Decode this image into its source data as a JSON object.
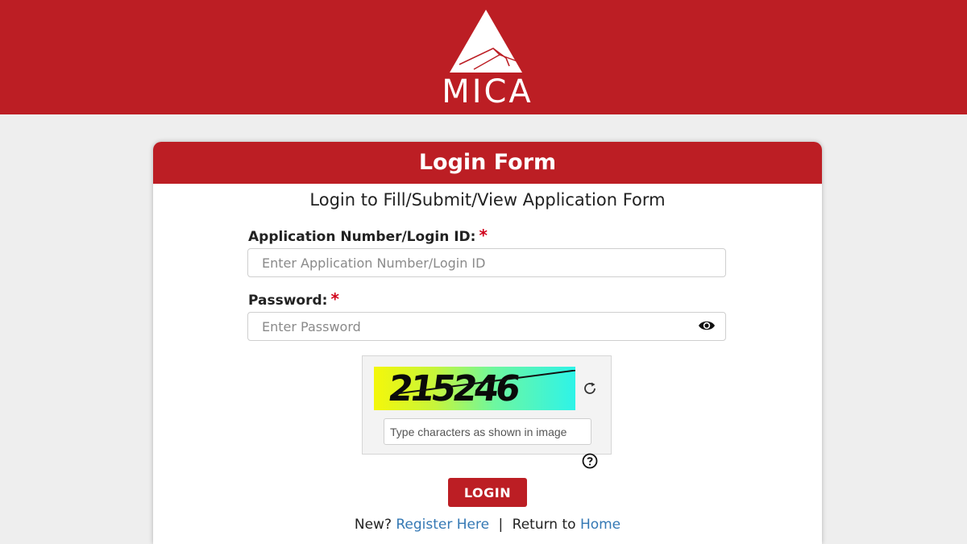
{
  "header": {
    "logo_text": "MICA",
    "brand_color": "#bc1e24"
  },
  "form": {
    "title": "Login Form",
    "subtitle": "Login to Fill/Submit/View Application Form",
    "login_id": {
      "label": "Application Number/Login ID:",
      "required_mark": "*",
      "value": "",
      "placeholder": "Enter Application Number/Login ID"
    },
    "password": {
      "label": "Password:",
      "required_mark": "*",
      "value": "",
      "placeholder": "Enter Password",
      "toggle_icon": "eye-icon"
    },
    "captcha": {
      "image_text": "215246",
      "refresh_icon": "refresh-icon",
      "input_value": "",
      "input_placeholder": "Type characters as shown in image",
      "help_icon": "question-circle-icon"
    },
    "login_button": "LOGIN",
    "footer": {
      "new_text": "New?",
      "register_link": "Register Here",
      "separator": "|",
      "return_text": "Return to",
      "home_link": "Home"
    }
  }
}
